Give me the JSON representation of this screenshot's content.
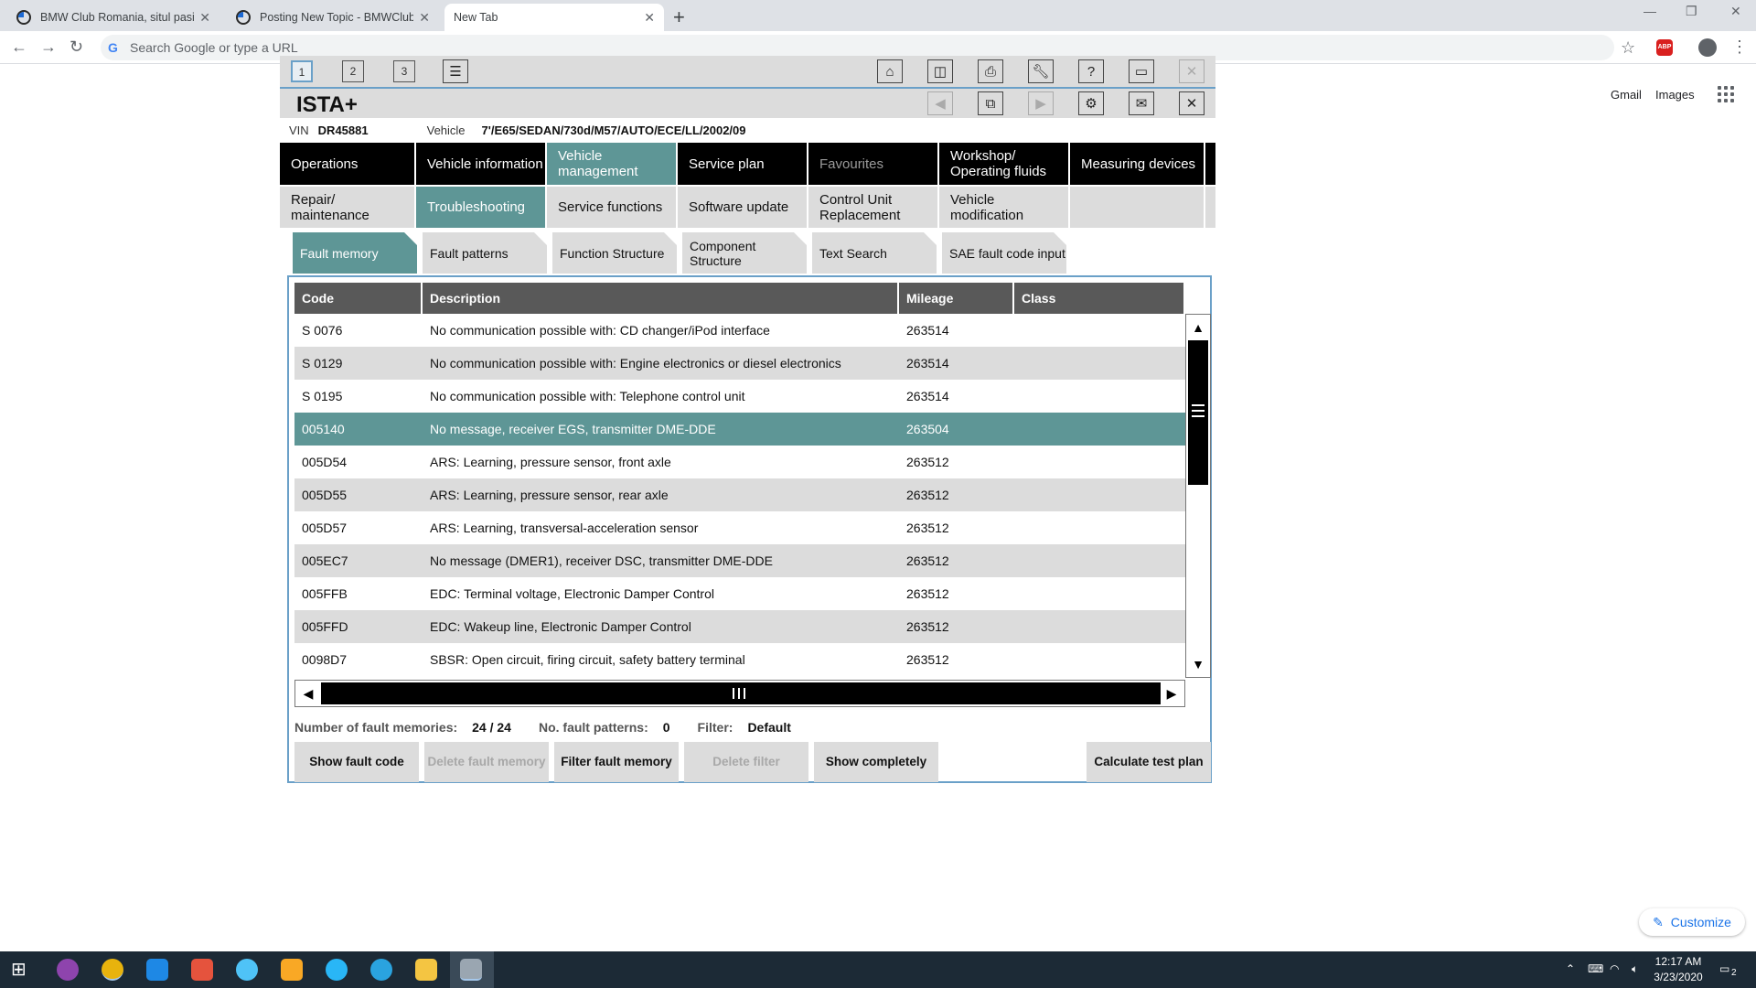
{
  "browser": {
    "tabs": [
      {
        "title": "BMW Club Romania, situl pasion",
        "active": false
      },
      {
        "title": "Posting New Topic - BMWClub",
        "active": false
      },
      {
        "title": "New Tab",
        "active": true
      }
    ],
    "omnibox_placeholder": "Search Google or type a URL",
    "abp_label": "ABP",
    "links": {
      "gmail": "Gmail",
      "images": "Images"
    },
    "customize": "Customize"
  },
  "ista": {
    "title": "ISTA+",
    "session_buttons": [
      "1",
      "2",
      "3"
    ],
    "vin_label": "VIN",
    "vin_value": "DR45881",
    "vehicle_label": "Vehicle",
    "vehicle_value": "7'/E65/SEDAN/730d/M57/AUTO/ECE/LL/2002/09",
    "main_nav": [
      {
        "label": "Operations",
        "state": "normal"
      },
      {
        "label": "Vehicle information",
        "state": "normal"
      },
      {
        "label": "Vehicle management",
        "state": "active"
      },
      {
        "label": "Service plan",
        "state": "normal"
      },
      {
        "label": "Favourites",
        "state": "dim"
      },
      {
        "label": "Workshop/ Operating fluids",
        "state": "normal"
      },
      {
        "label": "Measuring devices",
        "state": "normal"
      }
    ],
    "sub_nav": [
      {
        "label": "Repair/ maintenance",
        "state": "normal"
      },
      {
        "label": "Troubleshooting",
        "state": "active"
      },
      {
        "label": "Service functions",
        "state": "normal"
      },
      {
        "label": "Software update",
        "state": "normal"
      },
      {
        "label": "Control Unit Replacement",
        "state": "normal"
      },
      {
        "label": "Vehicle modification",
        "state": "normal"
      }
    ],
    "fault_tabs": [
      {
        "label": "Fault memory",
        "state": "active"
      },
      {
        "label": "Fault patterns",
        "state": "normal"
      },
      {
        "label": "Function Structure",
        "state": "normal"
      },
      {
        "label": "Component Structure",
        "state": "normal"
      },
      {
        "label": "Text Search",
        "state": "normal"
      },
      {
        "label": "SAE fault code input",
        "state": "normal"
      }
    ],
    "table": {
      "headers": [
        "Code",
        "Description",
        "Mileage",
        "Class"
      ],
      "rows": [
        {
          "code": "S 0076",
          "desc": "No communication possible with: CD changer/iPod interface",
          "mileage": "263514",
          "cls": ""
        },
        {
          "code": "S 0129",
          "desc": "No communication possible with: Engine electronics or diesel electronics",
          "mileage": "263514",
          "cls": ""
        },
        {
          "code": "S 0195",
          "desc": "No communication possible with: Telephone control unit",
          "mileage": "263514",
          "cls": ""
        },
        {
          "code": "005140",
          "desc": "No message, receiver EGS, transmitter DME-DDE",
          "mileage": "263504",
          "cls": ""
        },
        {
          "code": "005D54",
          "desc": "ARS: Learning, pressure sensor, front axle",
          "mileage": "263512",
          "cls": ""
        },
        {
          "code": "005D55",
          "desc": "ARS: Learning, pressure sensor, rear axle",
          "mileage": "263512",
          "cls": ""
        },
        {
          "code": "005D57",
          "desc": "ARS: Learning, transversal-acceleration sensor",
          "mileage": "263512",
          "cls": ""
        },
        {
          "code": "005EC7",
          "desc": "No message (DMER1), receiver DSC, transmitter DME-DDE",
          "mileage": "263512",
          "cls": ""
        },
        {
          "code": "005FFB",
          "desc": "EDC: Terminal voltage, Electronic Damper Control",
          "mileage": "263512",
          "cls": ""
        },
        {
          "code": "005FFD",
          "desc": "EDC: Wakeup line, Electronic Damper Control",
          "mileage": "263512",
          "cls": ""
        },
        {
          "code": "0098D7",
          "desc": "SBSR: Open circuit, firing circuit, safety battery terminal",
          "mileage": "263512",
          "cls": ""
        }
      ],
      "selected_index": 3
    },
    "summary": {
      "fault_memories_label": "Number of fault memories:",
      "fault_memories_value": "24 / 24",
      "fault_patterns_label": "No. fault patterns:",
      "fault_patterns_value": "0",
      "filter_label": "Filter:",
      "filter_value": "Default"
    },
    "actions": {
      "show_fault_code": "Show fault code",
      "delete_fault_memory": "Delete fault memory",
      "filter_fault_memory": "Filter fault memory",
      "delete_filter": "Delete filter",
      "show_completely": "Show completely",
      "calculate_test_plan": "Calculate test plan"
    }
  },
  "taskbar": {
    "time": "12:17 AM",
    "date": "3/23/2020",
    "notifications": "2"
  }
}
